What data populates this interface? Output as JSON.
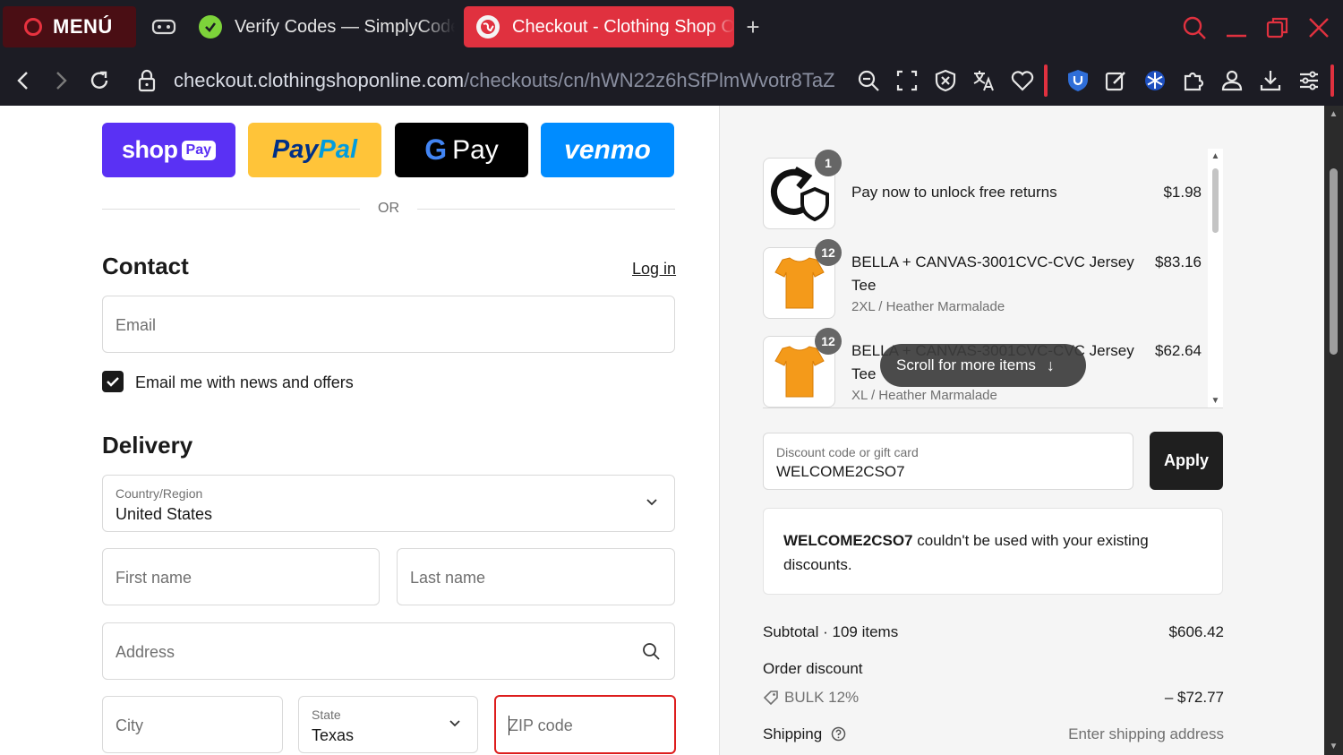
{
  "browser": {
    "menu_label": "MENÚ",
    "tabs": [
      {
        "title": "Verify Codes — SimplyCodes"
      },
      {
        "title": "Checkout - Clothing Shop Online"
      }
    ],
    "new_tab": "+",
    "url_domain": "checkout.clothingshoponline.com",
    "url_path": "/checkouts/cn/hWN22z6hSfPlmWvotr8TaZ"
  },
  "express": {
    "shop_label": "shop",
    "shop_pay": "Pay",
    "paypal_a": "Pay",
    "paypal_b": "Pal",
    "gpay_g": "G",
    "gpay_label": "Pay",
    "venmo_label": "venmo",
    "or_label": "OR"
  },
  "contact": {
    "heading": "Contact",
    "login": "Log in",
    "email_placeholder": "Email",
    "newsletter_label": "Email me with news and offers",
    "newsletter_checked": true
  },
  "delivery": {
    "heading": "Delivery",
    "country_label": "Country/Region",
    "country_value": "United States",
    "first_name": "First name",
    "last_name": "Last name",
    "address": "Address",
    "city": "City",
    "state_label": "State",
    "state_value": "Texas",
    "zip": "ZIP code"
  },
  "summary": {
    "items": [
      {
        "qty": "1",
        "name": "Pay now to unlock free returns",
        "variant": "",
        "price": "$1.98"
      },
      {
        "qty": "12",
        "name": "BELLA + CANVAS-3001CVC-CVC Jersey Tee",
        "variant": "2XL / Heather Marmalade",
        "price": "$83.16"
      },
      {
        "qty": "12",
        "name": "BELLA + CANVAS-3001CVC-CVC Jersey Tee",
        "variant": "XL / Heather Marmalade",
        "price": "$62.64"
      }
    ],
    "scroll_hint": "Scroll for more items",
    "discount_label": "Discount code or gift card",
    "discount_value": "WELCOME2CSO7",
    "apply": "Apply",
    "error_code": "WELCOME2CSO7",
    "error_text": " couldn't be used with your existing discounts.",
    "subtotal_label": "Subtotal · 109 items",
    "subtotal_value": "$606.42",
    "order_discount_label": "Order discount",
    "discount_name": "BULK 12%",
    "discount_amount": "– $72.77",
    "shipping_label": "Shipping",
    "shipping_value": "Enter shipping address"
  },
  "colors": {
    "brand_red": "#e0313f",
    "shop_pay": "#5a31f4",
    "paypal": "#ffc439",
    "venmo": "#008cff",
    "product_orange": "#f49a1a"
  }
}
